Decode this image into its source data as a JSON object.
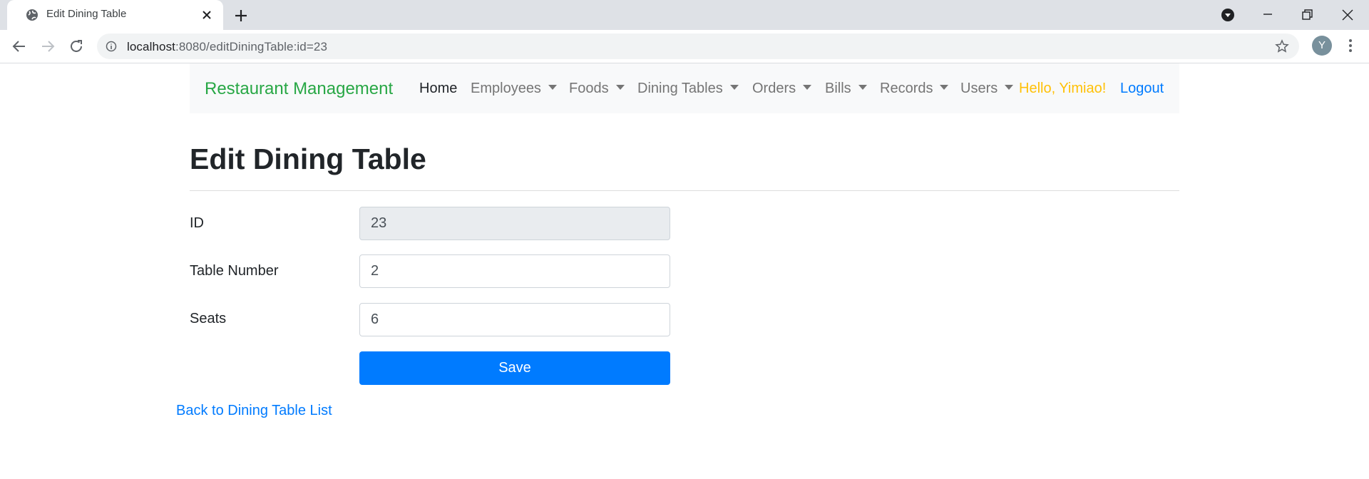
{
  "browser": {
    "tab_title": "Edit Dining Table",
    "url_host": "localhost",
    "url_rest": ":8080/editDiningTable:id=23",
    "profile_initial": "Y"
  },
  "navbar": {
    "brand": "Restaurant Management",
    "items": [
      {
        "label": "Home",
        "dropdown": false,
        "active": true
      },
      {
        "label": "Employees",
        "dropdown": true
      },
      {
        "label": "Foods",
        "dropdown": true
      },
      {
        "label": "Dining Tables",
        "dropdown": true
      },
      {
        "label": "Orders",
        "dropdown": true
      },
      {
        "label": "Bills",
        "dropdown": true
      },
      {
        "label": "Records",
        "dropdown": true
      },
      {
        "label": "Users",
        "dropdown": true
      }
    ],
    "greeting": "Hello, Yimiao!",
    "logout": "Logout"
  },
  "page": {
    "title": "Edit Dining Table",
    "fields": {
      "id": {
        "label": "ID",
        "value": "23"
      },
      "table_number": {
        "label": "Table Number",
        "value": "2"
      },
      "seats": {
        "label": "Seats",
        "value": "6"
      }
    },
    "save_label": "Save",
    "back_link": "Back to Dining Table List"
  },
  "colors": {
    "brand": "#28a745",
    "greeting": "#ffc107",
    "link": "#007bff",
    "primary_button": "#007bff"
  }
}
